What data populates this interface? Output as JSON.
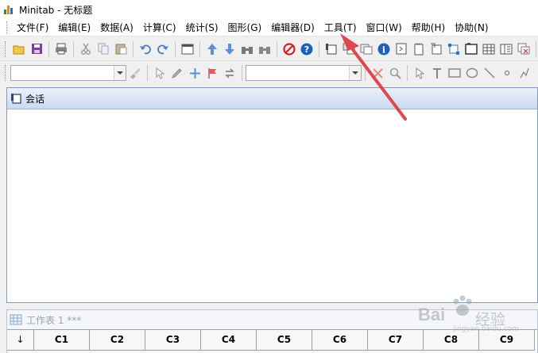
{
  "window": {
    "title": "Minitab - 无标题"
  },
  "menu": {
    "items": [
      {
        "label": "文件(F)",
        "name": "menu-file"
      },
      {
        "label": "编辑(E)",
        "name": "menu-edit"
      },
      {
        "label": "数据(A)",
        "name": "menu-data"
      },
      {
        "label": "计算(C)",
        "name": "menu-calc"
      },
      {
        "label": "统计(S)",
        "name": "menu-stat"
      },
      {
        "label": "图形(G)",
        "name": "menu-graph"
      },
      {
        "label": "编辑器(D)",
        "name": "menu-editor"
      },
      {
        "label": "工具(T)",
        "name": "menu-tools"
      },
      {
        "label": "窗口(W)",
        "name": "menu-window"
      },
      {
        "label": "帮助(H)",
        "name": "menu-help"
      },
      {
        "label": "协助(N)",
        "name": "menu-assistant"
      }
    ]
  },
  "toolbar": {
    "combo1_value": "",
    "combo2_value": ""
  },
  "session": {
    "title": "会话"
  },
  "worksheet": {
    "title": "工作表 1 ***",
    "corner": "↓",
    "columns": [
      "C1",
      "C2",
      "C3",
      "C4",
      "C5",
      "C6",
      "C7",
      "C8",
      "C9"
    ]
  },
  "watermark": {
    "brand": "Bai",
    "brand2": "经验",
    "url": "jingyan.baidu.com"
  },
  "colors": {
    "annotation_arrow": "#e0474c",
    "session_title_gradient_top": "#eaf1fb",
    "session_title_gradient_bottom": "#c9daf0"
  }
}
